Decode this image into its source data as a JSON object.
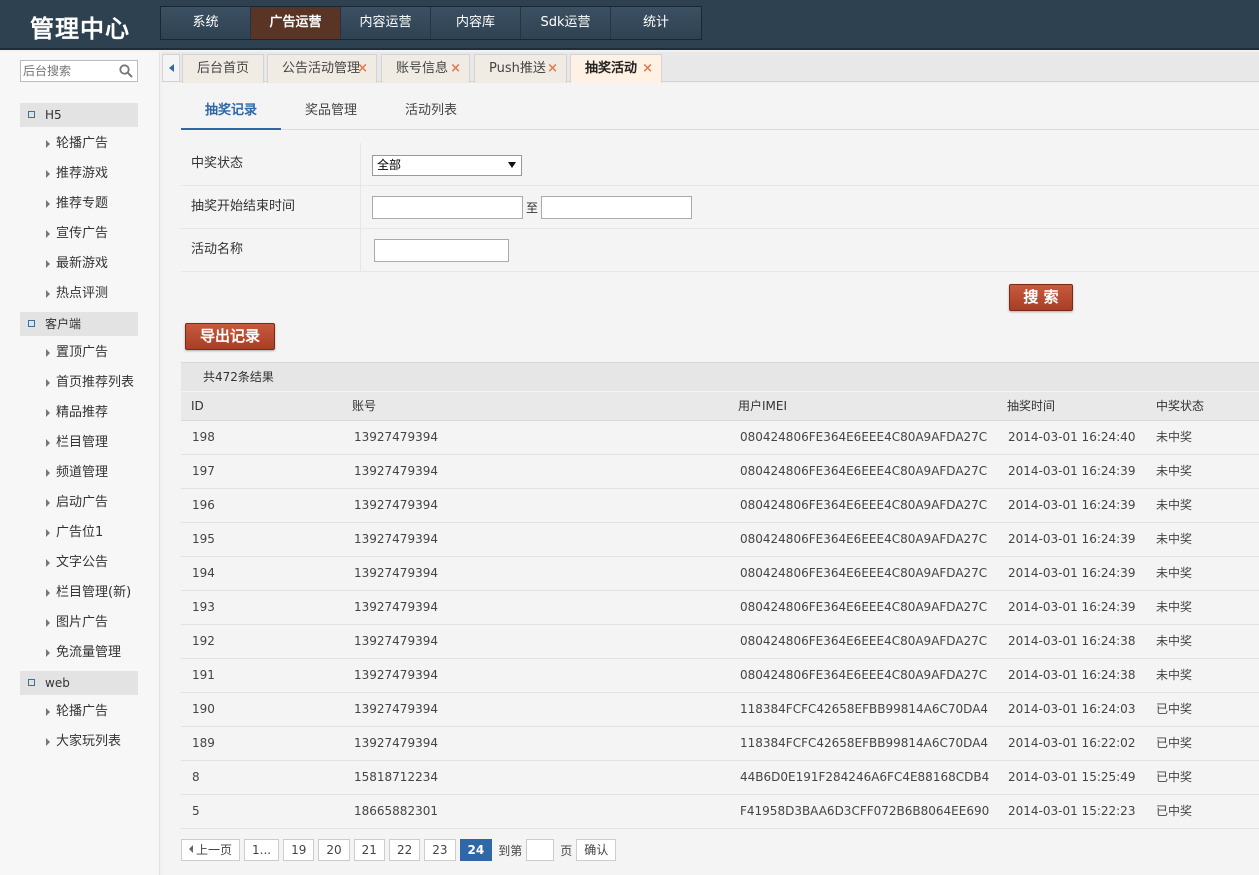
{
  "header": {
    "title": "管理中心",
    "nav": [
      "系统",
      "广告运营",
      "内容运营",
      "内容库",
      "Sdk运营",
      "统计"
    ],
    "active_nav": 1
  },
  "sidebar": {
    "search_placeholder": "后台搜索",
    "groups": [
      {
        "title": "H5",
        "items": [
          "轮播广告",
          "推荐游戏",
          "推荐专题",
          "宣传广告",
          "最新游戏",
          "热点评测"
        ]
      },
      {
        "title": "客户端",
        "items": [
          "置顶广告",
          "首页推荐列表",
          "精品推荐",
          "栏目管理",
          "频道管理",
          "启动广告",
          "广告位1",
          "文字公告",
          "栏目管理(新)",
          "图片广告",
          "免流量管理"
        ]
      },
      {
        "title": "web",
        "items": [
          "轮播广告",
          "大家玩列表"
        ]
      }
    ]
  },
  "tabs": [
    {
      "label": "后台首页",
      "closable": false
    },
    {
      "label": "公告活动管理",
      "closable": true
    },
    {
      "label": "账号信息",
      "closable": true
    },
    {
      "label": "Push推送",
      "closable": true
    },
    {
      "label": "抽奖活动",
      "closable": true,
      "active": true
    }
  ],
  "tab_close_glyph": "×",
  "subtabs": [
    "抽奖记录",
    "奖品管理",
    "活动列表"
  ],
  "form": {
    "status_label": "中奖状态",
    "status_value": "全部",
    "time_label": "抽奖开始结束时间",
    "time_sep": "至",
    "name_label": "活动名称"
  },
  "buttons": {
    "search": "搜 索",
    "export": "导出记录"
  },
  "result_summary": "共472条结果",
  "table": {
    "columns": [
      "ID",
      "账号",
      "用户IMEI",
      "抽奖时间",
      "中奖状态"
    ],
    "rows": [
      [
        "198",
        "13927479394",
        "080424806FE364E6EEE4C80A9AFDA27C",
        "2014-03-01 16:24:40",
        "未中奖"
      ],
      [
        "197",
        "13927479394",
        "080424806FE364E6EEE4C80A9AFDA27C",
        "2014-03-01 16:24:39",
        "未中奖"
      ],
      [
        "196",
        "13927479394",
        "080424806FE364E6EEE4C80A9AFDA27C",
        "2014-03-01 16:24:39",
        "未中奖"
      ],
      [
        "195",
        "13927479394",
        "080424806FE364E6EEE4C80A9AFDA27C",
        "2014-03-01 16:24:39",
        "未中奖"
      ],
      [
        "194",
        "13927479394",
        "080424806FE364E6EEE4C80A9AFDA27C",
        "2014-03-01 16:24:39",
        "未中奖"
      ],
      [
        "193",
        "13927479394",
        "080424806FE364E6EEE4C80A9AFDA27C",
        "2014-03-01 16:24:39",
        "未中奖"
      ],
      [
        "192",
        "13927479394",
        "080424806FE364E6EEE4C80A9AFDA27C",
        "2014-03-01 16:24:38",
        "未中奖"
      ],
      [
        "191",
        "13927479394",
        "080424806FE364E6EEE4C80A9AFDA27C",
        "2014-03-01 16:24:38",
        "未中奖"
      ],
      [
        "190",
        "13927479394",
        "118384FCFC42658EFBB99814A6C70DA4",
        "2014-03-01 16:24:03",
        "已中奖"
      ],
      [
        "189",
        "13927479394",
        "118384FCFC42658EFBB99814A6C70DA4",
        "2014-03-01 16:22:02",
        "已中奖"
      ],
      [
        "8",
        "15818712234",
        "44B6D0E191F284246A6FC4E88168CDB4",
        "2014-03-01 15:25:49",
        "已中奖"
      ],
      [
        "5",
        "18665882301",
        "F41958D3BAA6D3CFF072B6B8064EE690",
        "2014-03-01 15:22:23",
        "已中奖"
      ]
    ]
  },
  "pager": {
    "prev": "上一页",
    "pages": [
      "1...",
      "19",
      "20",
      "21",
      "22",
      "23",
      "24"
    ],
    "current": "24",
    "goto_prefix": "到第",
    "goto_suffix": "页",
    "confirm": "确认"
  },
  "colors": {
    "header_bg": "#2e4150",
    "active_nav_bg": "#5a3424",
    "accent_blue": "#2f68a7",
    "button_red": "#b84a30",
    "tab_close": "#e07a52"
  }
}
